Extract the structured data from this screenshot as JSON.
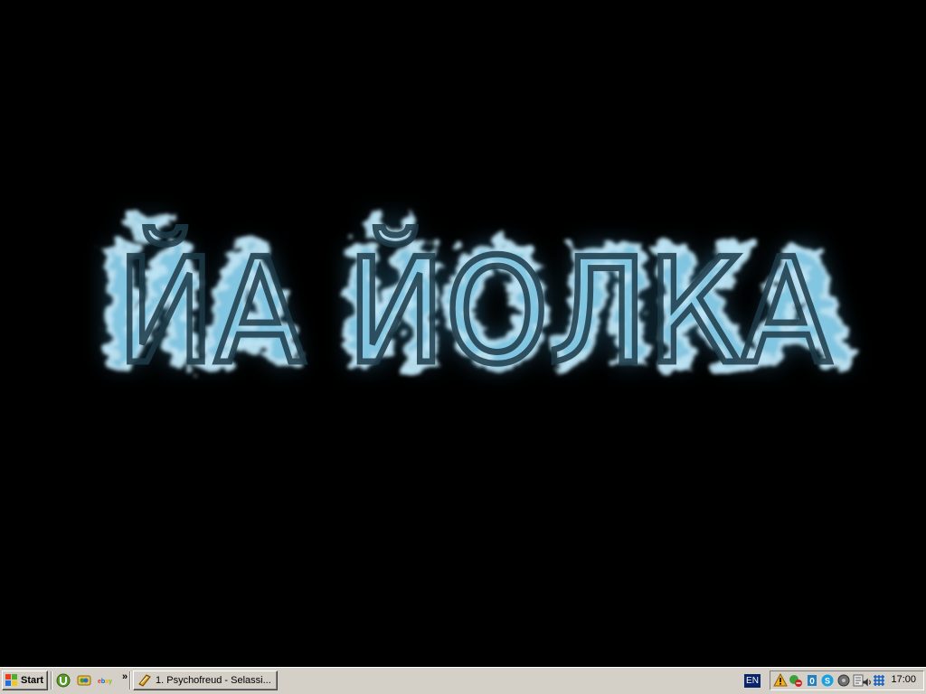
{
  "wallpaper": {
    "text": "ЙА ЙОЛКА",
    "glow_color": "#7fc8e8",
    "text_color": "#1d3a48"
  },
  "taskbar": {
    "start_label": "Start",
    "quick_launch": [
      "utorrent-icon",
      "messenger-icon",
      "ebay-icon"
    ],
    "chevron": "»",
    "task_label": "1. Psychofreud - Selassi...",
    "language": "EN",
    "tray_icons": [
      "warning-icon",
      "security-icon",
      "antivirus-icon",
      "skype-icon",
      "network-icon",
      "cd-icon",
      "speaker-icon",
      "network-grid-icon"
    ],
    "clock": "17:00"
  }
}
